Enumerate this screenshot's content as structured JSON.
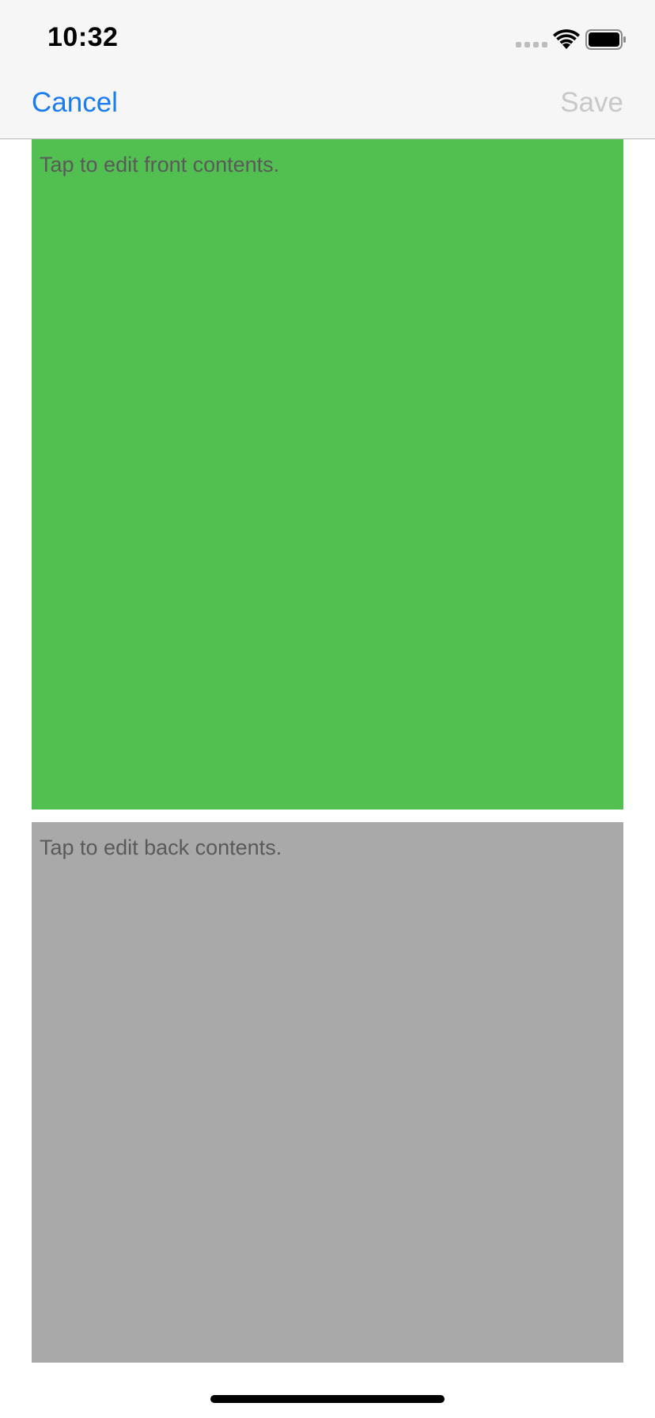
{
  "status_bar": {
    "time": "10:32"
  },
  "nav": {
    "cancel_label": "Cancel",
    "save_label": "Save",
    "cancel_color": "#1a7cf0",
    "save_color": "#c8c8c8"
  },
  "cards": {
    "front": {
      "placeholder": "Tap to edit front contents.",
      "color": "#52bf51"
    },
    "back": {
      "placeholder": "Tap to edit back contents.",
      "color": "#a9a9a9"
    }
  },
  "icons": {
    "signal": "signal-strength-icon",
    "wifi": "wifi-icon",
    "battery": "battery-icon"
  }
}
